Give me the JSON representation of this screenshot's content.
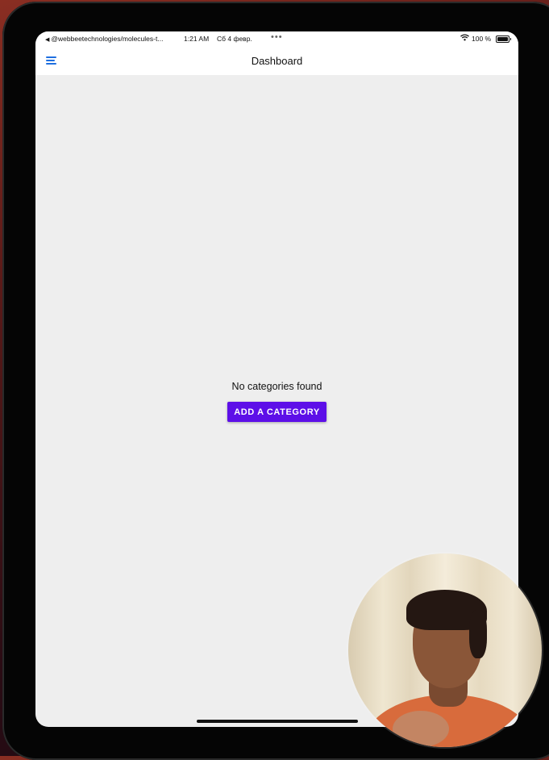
{
  "status_bar": {
    "back_arrow": "◀",
    "back_label": "@webbeetechnologies/molecules-t...",
    "time": "1:21 AM",
    "date": "Сб 4 февр.",
    "multitask_dots": "•••",
    "wifi_icon": "wifi-icon",
    "battery_percent": "100 %",
    "battery_level": 1.0
  },
  "app_bar": {
    "menu_icon": "hamburger-menu-icon",
    "title": "Dashboard",
    "accent_color": "#1e6fe0"
  },
  "main": {
    "empty_message": "No categories found",
    "add_button_label": "ADD A CATEGORY",
    "button_color": "#5d0fe8"
  }
}
